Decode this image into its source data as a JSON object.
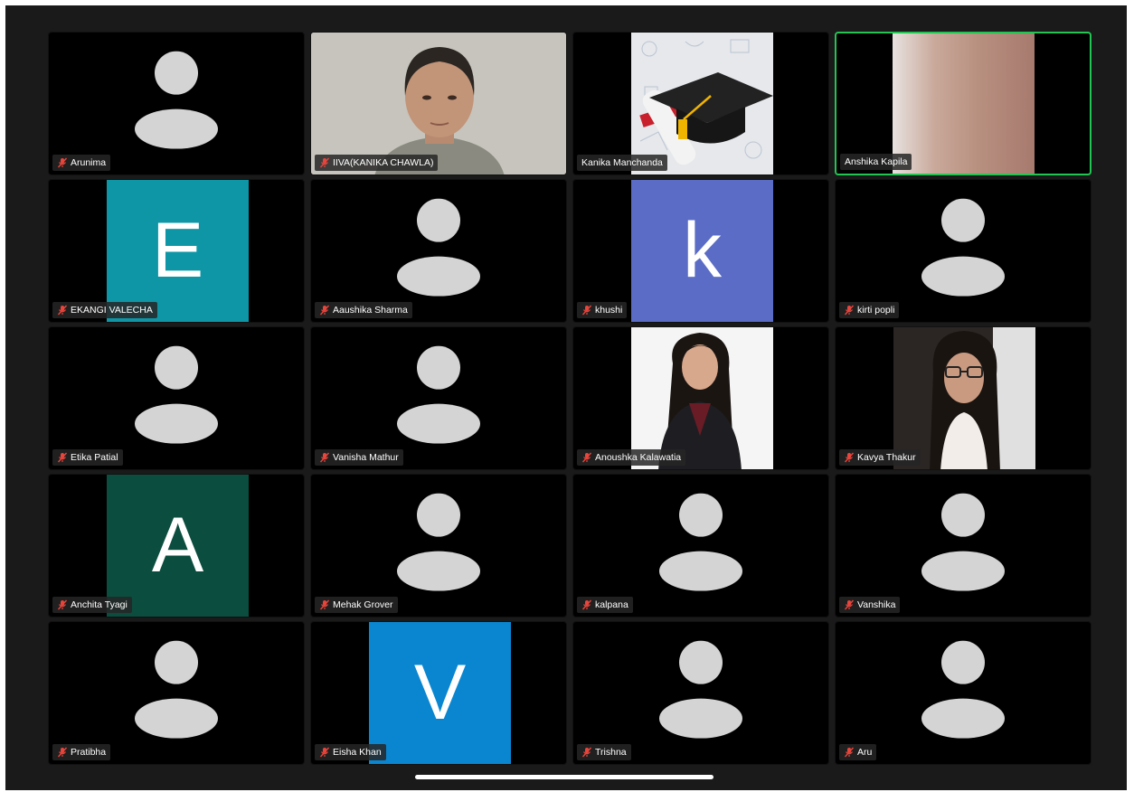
{
  "colors": {
    "tile_bg": "#000000",
    "frame_bg": "#1a1a1a",
    "active_border": "#23c552",
    "avatar_gray": "#d4d4d4",
    "muted_mic": "#e8453c"
  },
  "participants": [
    {
      "name": "Arunima",
      "muted": true
    },
    {
      "name": "IIVA(KANIKA CHAWLA)",
      "muted": true
    },
    {
      "name": "Kanika Manchanda",
      "muted": false
    },
    {
      "name": "Anshika Kapila",
      "muted": false
    },
    {
      "name": "EKANGI VALECHA",
      "muted": true,
      "initial": "E"
    },
    {
      "name": "Aaushika Sharma",
      "muted": true
    },
    {
      "name": "khushi",
      "muted": true,
      "initial": "k"
    },
    {
      "name": "kirti popli",
      "muted": true
    },
    {
      "name": "Etika Patial",
      "muted": true
    },
    {
      "name": "Vanisha Mathur",
      "muted": true
    },
    {
      "name": "Anoushka Kalawatia",
      "muted": true
    },
    {
      "name": "Kavya Thakur",
      "muted": true
    },
    {
      "name": "Anchita Tyagi",
      "muted": true,
      "initial": "A"
    },
    {
      "name": "Mehak Grover",
      "muted": true
    },
    {
      "name": "kalpana",
      "muted": true
    },
    {
      "name": "Vanshika",
      "muted": true
    },
    {
      "name": "Pratibha",
      "muted": true
    },
    {
      "name": "Eisha Khan",
      "muted": true,
      "initial": "V"
    },
    {
      "name": "Trishna",
      "muted": true
    },
    {
      "name": "Aru",
      "muted": true
    }
  ]
}
